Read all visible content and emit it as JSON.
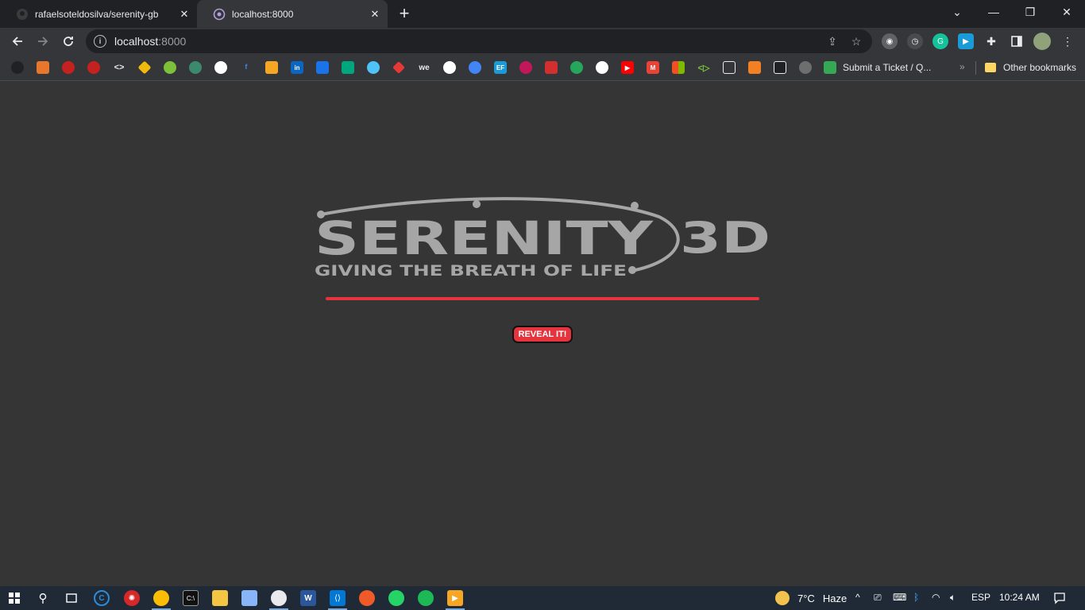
{
  "browser": {
    "tabs": [
      {
        "title": "rafaelsoteldosilva/serenity-gb",
        "icon": "github-icon",
        "active": false
      },
      {
        "title": "localhost:8000",
        "icon": "globe-icon",
        "active": true
      }
    ],
    "url_host": "localhost",
    "url_port": ":8000"
  },
  "bookmarks": {
    "ticket_label": "Submit a Ticket / Q...",
    "more_label": "»",
    "other_label": "Other bookmarks"
  },
  "page": {
    "logo_main": "SERENITY",
    "logo_suffix": "3D",
    "logo_tagline": "GIVING THE BREATH OF LIFE",
    "reveal_label": "REVEAL IT!"
  },
  "taskbar": {
    "weather_temp": "7°C",
    "weather_desc": "Haze",
    "language": "ESP",
    "time": "10:24 AM"
  },
  "colors": {
    "page_bg": "#353535",
    "accent_red": "#e5343d",
    "logo_gray": "#a6a6a6"
  }
}
